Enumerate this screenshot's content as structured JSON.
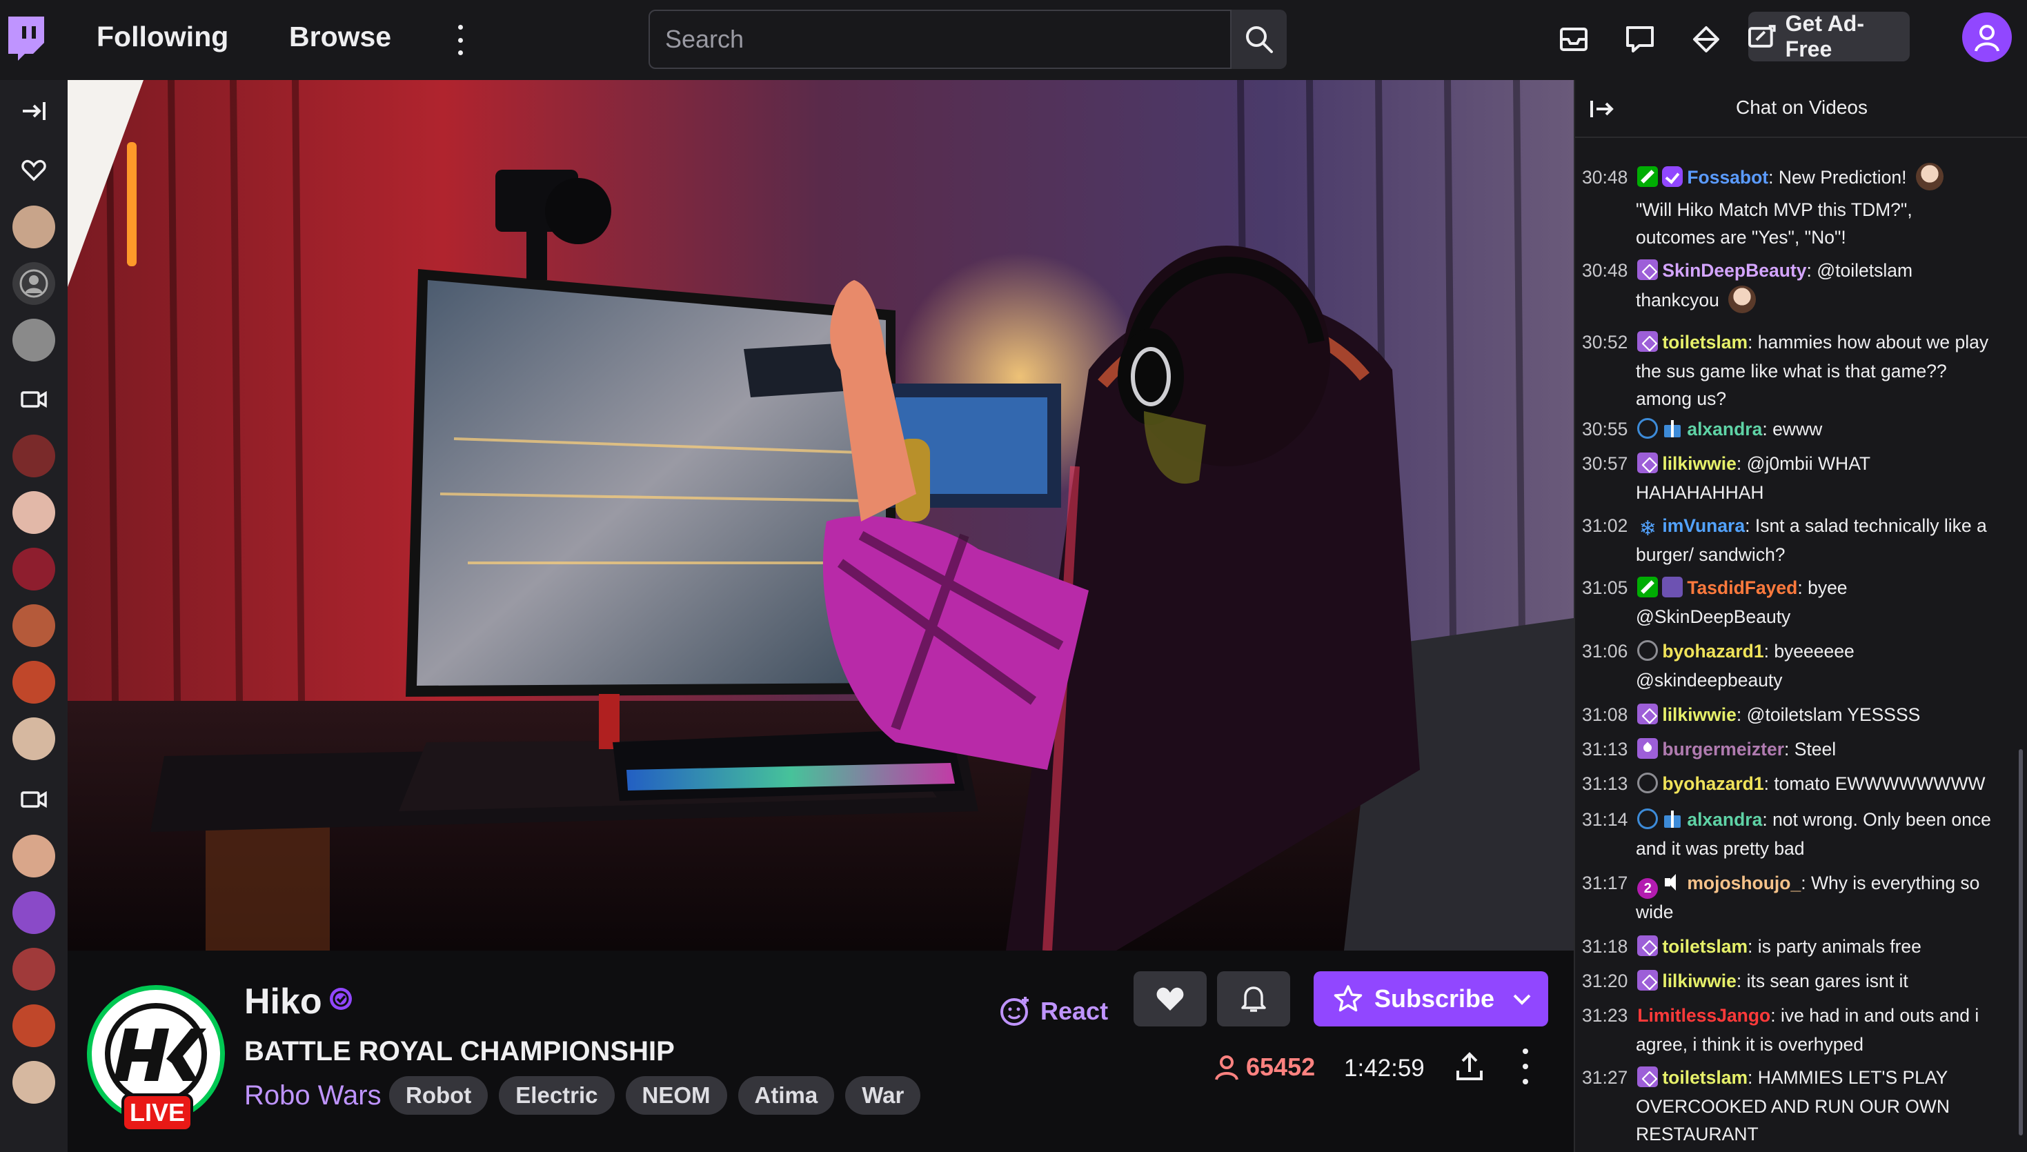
{
  "nav": {
    "following": "Following",
    "browse": "Browse",
    "search_placeholder": "Search",
    "ad_free": "Get Ad-Free"
  },
  "icons": {
    "logo": "twitch-logo-icon",
    "search": "search-icon",
    "inbox": "inbox-icon",
    "whispers": "whispers-icon",
    "prime": "prime-crown-icon",
    "user": "user-avatar-icon"
  },
  "sidebar": {
    "collapse_icon": "sidebar-expand-icon",
    "sections": [
      "followed-heart-icon",
      "recommended-video-icon",
      "similar-video-icon"
    ]
  },
  "channel": {
    "name": "Hiko",
    "title": "BATTLE ROYAL CHAMPIONSHIP",
    "category": "Robo Wars",
    "tags": [
      "Robot",
      "Electric",
      "NEOM",
      "Atima",
      "War"
    ],
    "live": "LIVE",
    "viewers": "65452",
    "uptime": "1:42:59",
    "react": "React",
    "subscribe": "Subscribe",
    "accent": "#9147ff"
  },
  "chat": {
    "title": "Chat on Videos",
    "messages": [
      {
        "ts": "30:48",
        "badges": [
          "mod",
          "verified"
        ],
        "user": "Fossabot",
        "color": "#5b9bff",
        "text": ": New Prediction! ",
        "emote": true
      },
      {
        "ts": "",
        "badges": [],
        "user": "",
        "color": "#efeff1",
        "text": "\"Will Hiko Match MVP this TDM?\",",
        "emote": false
      },
      {
        "ts": "",
        "badges": [],
        "user": "",
        "color": "#efeff1",
        "text": "outcomes are \"Yes\", \"No\"!",
        "emote": false
      },
      {
        "ts": "30:48",
        "badges": [
          "sub"
        ],
        "user": "SkinDeepBeauty",
        "color": "#d4a5ff",
        "text": ": @toiletslam",
        "emote": false
      },
      {
        "ts": "",
        "badges": [],
        "user": "",
        "color": "#efeff1",
        "text": "thankcyou ",
        "emote": true
      },
      {
        "ts": "30:52",
        "badges": [
          "sub"
        ],
        "user": "toiletslam",
        "color": "#e6f06a",
        "text": ": hammies how about we play",
        "emote": false
      },
      {
        "ts": "",
        "badges": [],
        "user": "",
        "color": "#efeff1",
        "text": "the sus game like what is that game??",
        "emote": false
      },
      {
        "ts": "",
        "badges": [],
        "user": "",
        "color": "#efeff1",
        "text": "among us?",
        "emote": false
      },
      {
        "ts": "30:55",
        "badges": [
          "circle-blue",
          "gift"
        ],
        "user": "alxandra",
        "color": "#5fd3a6",
        "text": ": ewww",
        "emote": false
      },
      {
        "ts": "30:57",
        "badges": [
          "sub"
        ],
        "user": "lilkiwwie",
        "color": "#e6f06a",
        "text": ": @j0mbii WHAT",
        "emote": false
      },
      {
        "ts": "",
        "badges": [],
        "user": "",
        "color": "#efeff1",
        "text": "HAHAHAHHAH",
        "emote": false
      },
      {
        "ts": "31:02",
        "badges": [
          "snow"
        ],
        "user": "imVunara",
        "color": "#53a3ff",
        "text": ": Isnt a salad technically like a",
        "emote": false
      },
      {
        "ts": "",
        "badges": [],
        "user": "",
        "color": "#efeff1",
        "text": "burger/ sandwich?",
        "emote": false
      },
      {
        "ts": "31:05",
        "badges": [
          "mod",
          "bits"
        ],
        "user": "TasdidFayed",
        "color": "#ff7a3d",
        "text": ": byee",
        "emote": false
      },
      {
        "ts": "",
        "badges": [],
        "user": "",
        "color": "#efeff1",
        "text": "@SkinDeepBeauty",
        "emote": false
      },
      {
        "ts": "31:06",
        "badges": [
          "circle"
        ],
        "user": "byohazard1",
        "color": "#f0e35a",
        "text": ": byeeeeee",
        "emote": false
      },
      {
        "ts": "",
        "badges": [],
        "user": "",
        "color": "#efeff1",
        "text": "@skindeepbeauty",
        "emote": false
      },
      {
        "ts": "31:08",
        "badges": [
          "sub"
        ],
        "user": "lilkiwwie",
        "color": "#e6f06a",
        "text": ": @toiletslam YESSSS",
        "emote": false
      },
      {
        "ts": "31:13",
        "badges": [
          "drop"
        ],
        "user": "burgermeizter",
        "color": "#b07bb0",
        "text": ": Steel",
        "emote": false
      },
      {
        "ts": "31:13",
        "badges": [
          "circle"
        ],
        "user": "byohazard1",
        "color": "#f0e35a",
        "text": ": tomato EWWWWWWWW",
        "emote": false
      },
      {
        "ts": "31:14",
        "badges": [
          "circle-blue",
          "gift"
        ],
        "user": "alxandra",
        "color": "#5fd3a6",
        "text": ": not wrong. Only been once",
        "emote": false
      },
      {
        "ts": "",
        "badges": [],
        "user": "",
        "color": "#efeff1",
        "text": "and it was pretty bad",
        "emote": false
      },
      {
        "ts": "31:17",
        "badges": [
          "two",
          "mute"
        ],
        "user": "mojoshoujo_",
        "color": "#f5c28a",
        "text": ": Why is everything so",
        "emote": false
      },
      {
        "ts": "",
        "badges": [],
        "user": "",
        "color": "#efeff1",
        "text": "wide",
        "emote": false
      },
      {
        "ts": "31:18",
        "badges": [
          "sub"
        ],
        "user": "toiletslam",
        "color": "#e6f06a",
        "text": ": is party animals free",
        "emote": false
      },
      {
        "ts": "31:20",
        "badges": [
          "sub"
        ],
        "user": "lilkiwwie",
        "color": "#e6f06a",
        "text": ": its sean gares isnt it",
        "emote": false
      },
      {
        "ts": "31:23",
        "badges": [],
        "user": "LimitlessJango",
        "color": "#ff3a3a",
        "text": ": ive had in and outs and i",
        "emote": false
      },
      {
        "ts": "",
        "badges": [],
        "user": "",
        "color": "#efeff1",
        "text": "agree, i think it is overhyped",
        "emote": false
      },
      {
        "ts": "31:27",
        "badges": [
          "sub"
        ],
        "user": "toiletslam",
        "color": "#e6f06a",
        "text": ": HAMMIES LET'S PLAY",
        "emote": false
      },
      {
        "ts": "",
        "badges": [],
        "user": "",
        "color": "#efeff1",
        "text": "OVERCOOKED AND RUN OUR OWN",
        "emote": false
      },
      {
        "ts": "",
        "badges": [],
        "user": "",
        "color": "#efeff1",
        "text": "RESTAURANT",
        "emote": false
      }
    ]
  }
}
